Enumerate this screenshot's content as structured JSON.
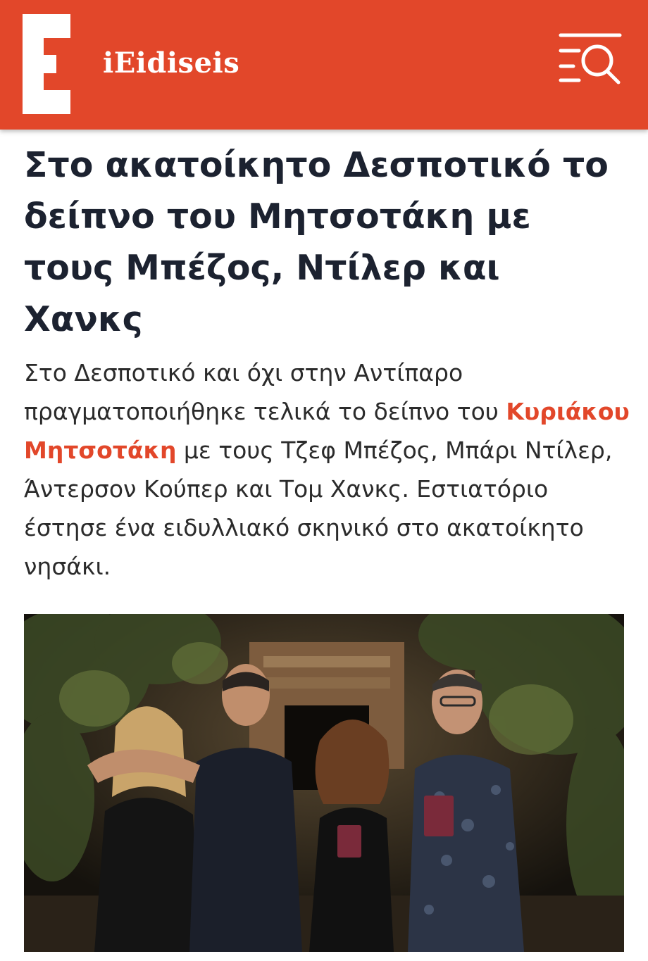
{
  "header": {
    "brand_name": "iEidiseis",
    "brand_color": "#e2472a",
    "logo_icon": "e-logo-icon",
    "menu_icon": "menu-search-icon"
  },
  "article": {
    "headline": "Στο ακατοίκητο Δεσποτικό το δείπνο του Μητσοτάκη με τους Μπέζος, Ντίλερ και Χανκς",
    "lead_before": "Στο Δεσποτικό και όχι στην Αντίπαρο πραγματοποιήθηκε τελικά το δείπνο του ",
    "lead_highlight": "Κυριάκου Μητσοτάκη",
    "lead_after": " με τους Τζεφ Μπέζος, Μπάρι Ντίλερ, Άντερσον Κούπερ και Τομ Χανκς. Εστιατόριο έστησε ένα ειδυλλιακό σκηνικό στο ακατοίκητο νησάκι.",
    "highlight_color": "#e2472a",
    "photo_icon": "article-photo"
  }
}
